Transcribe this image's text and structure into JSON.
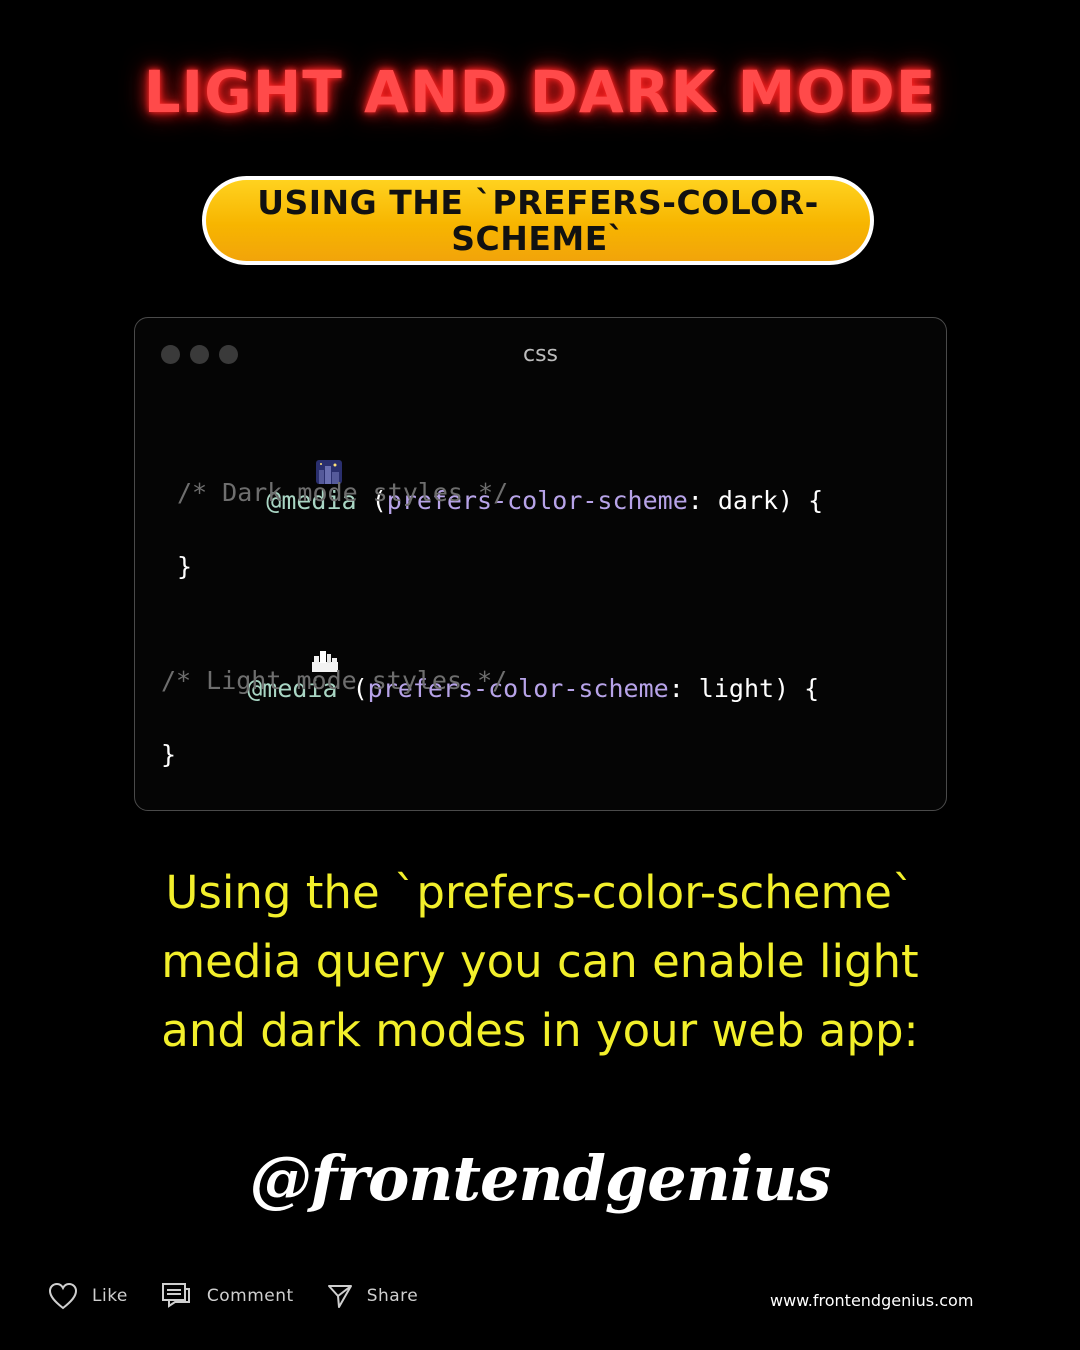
{
  "title": "LIGHT AND DARK MODE",
  "subtitle_pill": "USING THE `PREFERS-COLOR-SCHEME`",
  "code_card": {
    "language": "css",
    "line1": {
      "icon": "night-city-emoji-icon",
      "at_rule": "@media",
      "open_paren": "(",
      "feature": "prefers-color-scheme",
      "rest": ": dark) {"
    },
    "line2_comment": "/* Dark mode styles */",
    "line3_close": "}",
    "line4": {
      "icon": "cityscape-emoji-icon",
      "at_rule": "@media",
      "open_paren": "(",
      "feature": "prefers-color-scheme",
      "rest": ": light) {"
    },
    "line5_comment": "/* Light mode styles */",
    "line6_close": "}"
  },
  "description": {
    "line1": "Using the `prefers-color-scheme`",
    "line2": "media query you can enable light",
    "line3": "and dark modes in your web app:"
  },
  "handle": "@frontendgenius",
  "actions": {
    "like": "Like",
    "comment": "Comment",
    "share": "Share"
  },
  "website": "www.frontendgenius.com",
  "colors": {
    "background": "#000000",
    "title_neon": "#ff4a4a",
    "pill_yellow": "#f7b500",
    "description_yellow": "#f2ef2b",
    "code_keyword": "#a9d6c4",
    "code_property": "#b7a3e8",
    "code_comment": "#6e6e6e"
  }
}
